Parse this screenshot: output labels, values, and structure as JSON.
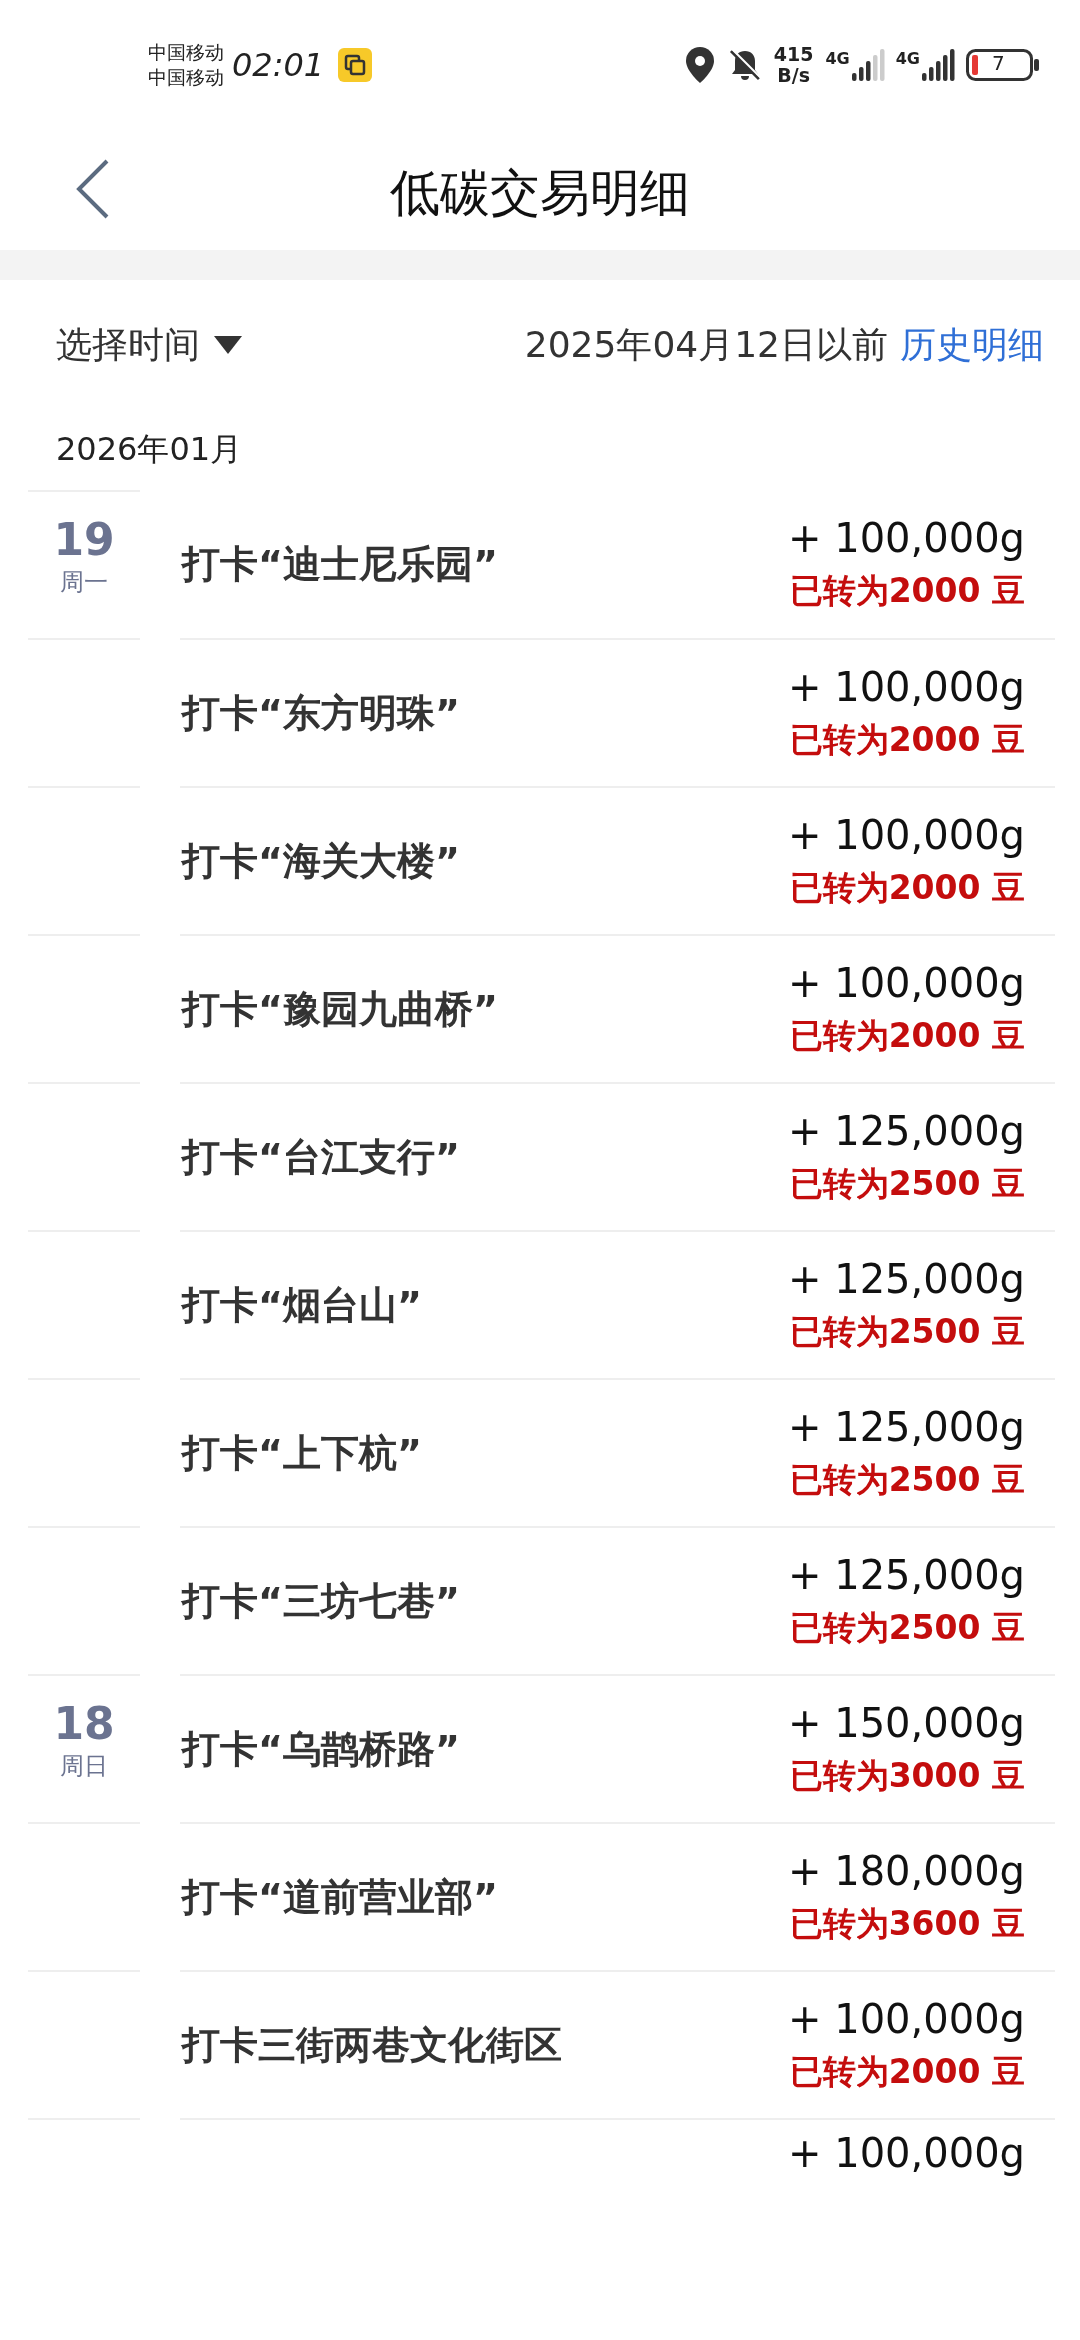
{
  "status_bar": {
    "carriers": [
      "中国移动",
      "中国移动"
    ],
    "time": "02:01",
    "net_speed": "415",
    "net_unit": "B/s",
    "sim_labels": [
      "4G",
      "4G"
    ],
    "battery": "7"
  },
  "header": {
    "title": "低碳交易明细"
  },
  "filter": {
    "label": "选择时间",
    "note": "2025年04月12日以前",
    "link": "历史明细"
  },
  "month": "2026年01月",
  "days": [
    {
      "day": "19",
      "weekday": "周一",
      "rows": [
        {
          "title": "打卡“迪士尼乐园”",
          "amount": "+ 100,000g",
          "converted": "已转为2000 豆"
        },
        {
          "title": "打卡“东方明珠”",
          "amount": "+ 100,000g",
          "converted": "已转为2000 豆"
        },
        {
          "title": "打卡“海关大楼”",
          "amount": "+ 100,000g",
          "converted": "已转为2000 豆"
        },
        {
          "title": "打卡“豫园九曲桥”",
          "amount": "+ 100,000g",
          "converted": "已转为2000 豆"
        },
        {
          "title": "打卡“台江支行”",
          "amount": "+ 125,000g",
          "converted": "已转为2500 豆"
        },
        {
          "title": "打卡“烟台山”",
          "amount": "+ 125,000g",
          "converted": "已转为2500 豆"
        },
        {
          "title": "打卡“上下杭”",
          "amount": "+ 125,000g",
          "converted": "已转为2500 豆"
        },
        {
          "title": "打卡“三坊七巷”",
          "amount": "+ 125,000g",
          "converted": "已转为2500 豆"
        }
      ]
    },
    {
      "day": "18",
      "weekday": "周日",
      "rows": [
        {
          "title": "打卡“乌鹊桥路”",
          "amount": "+ 150,000g",
          "converted": "已转为3000 豆"
        },
        {
          "title": "打卡“道前营业部”",
          "amount": "+ 180,000g",
          "converted": "已转为3600 豆"
        },
        {
          "title": "打卡三街两巷文化街区",
          "amount": "+ 100,000g",
          "converted": "已转为2000 豆"
        },
        {
          "amount": "+ 100,000g"
        }
      ]
    }
  ]
}
